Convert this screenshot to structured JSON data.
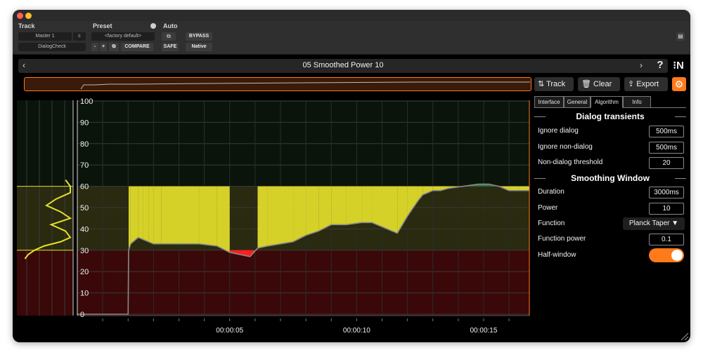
{
  "host": {
    "track_label": "Track",
    "preset_label": "Preset",
    "auto_label": "Auto",
    "track_name": "Master 1",
    "track_channel": "c",
    "insert_name": "DialogCheck",
    "preset_value": "<factory default>",
    "minus": "-",
    "plus": "+",
    "compare": "COMPARE",
    "bypass": "BYPASS",
    "safe": "SAFE",
    "native": "Native"
  },
  "nav": {
    "title": "05 Smoothed Power 10",
    "prev": "‹",
    "next": "›",
    "help": "?",
    "logo": "N"
  },
  "toolbar": {
    "track": "Track",
    "clear": "Clear",
    "export": "Export"
  },
  "tabs": [
    "Interface",
    "General",
    "Algorithm",
    "Info"
  ],
  "active_tab": "Algorithm",
  "dialog_transients": {
    "title": "Dialog transients",
    "ignore_dialog_label": "Ignore dialog",
    "ignore_dialog_value": "500ms",
    "ignore_nondialog_label": "Ignore non-dialog",
    "ignore_nondialog_value": "500ms",
    "threshold_label": "Non-dialog threshold",
    "threshold_value": "20"
  },
  "smoothing": {
    "title": "Smoothing Window",
    "duration_label": "Duration",
    "duration_value": "3000ms",
    "power_label": "Power",
    "power_value": "10",
    "function_label": "Function",
    "function_value": "Planck Taper ▼",
    "function_power_label": "Function power",
    "function_power_value": "0.1",
    "half_window_label": "Half-window",
    "half_window_on": true
  },
  "colors": {
    "accent": "#ff7a1a",
    "target_band": "#e5e02a",
    "below_band": "#3a0808",
    "low_value": "#ff2020",
    "high_value": "#2e7a3a"
  },
  "chart_data": {
    "type": "line",
    "y_ticks": [
      0,
      10,
      20,
      30,
      40,
      50,
      60,
      70,
      80,
      90,
      100
    ],
    "ylim": [
      0,
      100
    ],
    "target_range": [
      30,
      60
    ],
    "x_ticks": [
      "00:00:05",
      "00:00:10",
      "00:00:15"
    ],
    "x_tick_seconds": [
      5,
      10,
      15
    ],
    "xlim": [
      -1,
      16.8
    ],
    "series": [
      {
        "x": [
          -1,
          0.2,
          1.0,
          1.02,
          1.1,
          1.4,
          1.6,
          1.8,
          2.0,
          2.3,
          3.0,
          3.8,
          4.5,
          5.0,
          5.4,
          5.8,
          6.1,
          6.5,
          7.0,
          7.5,
          8.0,
          8.5,
          9.0,
          9.6,
          10.2,
          10.6,
          11.0,
          11.6,
          12.0,
          12.4,
          12.6,
          12.8,
          13.0,
          13.3,
          13.6,
          14.2,
          14.8,
          15.2,
          15.6,
          16.0,
          16.4,
          16.8
        ],
        "y": [
          0,
          0,
          0,
          30,
          33,
          36,
          35,
          34,
          33,
          33,
          33,
          33,
          32,
          29,
          28,
          27,
          31,
          32,
          33,
          34,
          37,
          39,
          42,
          42,
          43,
          43,
          41,
          38,
          46,
          53,
          56,
          57,
          58,
          58,
          59,
          60,
          61,
          61,
          60,
          58,
          58,
          58
        ]
      }
    ],
    "histogram_y": [
      63,
      60,
      57,
      54,
      51,
      48,
      45,
      42,
      39,
      36,
      34,
      32,
      30,
      28,
      26
    ],
    "histogram_density": [
      0.9,
      1.0,
      1.0,
      0.7,
      0.5,
      0.8,
      1.0,
      0.6,
      0.9,
      1.0,
      0.8,
      0.45,
      0.25,
      0.12,
      0.05
    ]
  }
}
